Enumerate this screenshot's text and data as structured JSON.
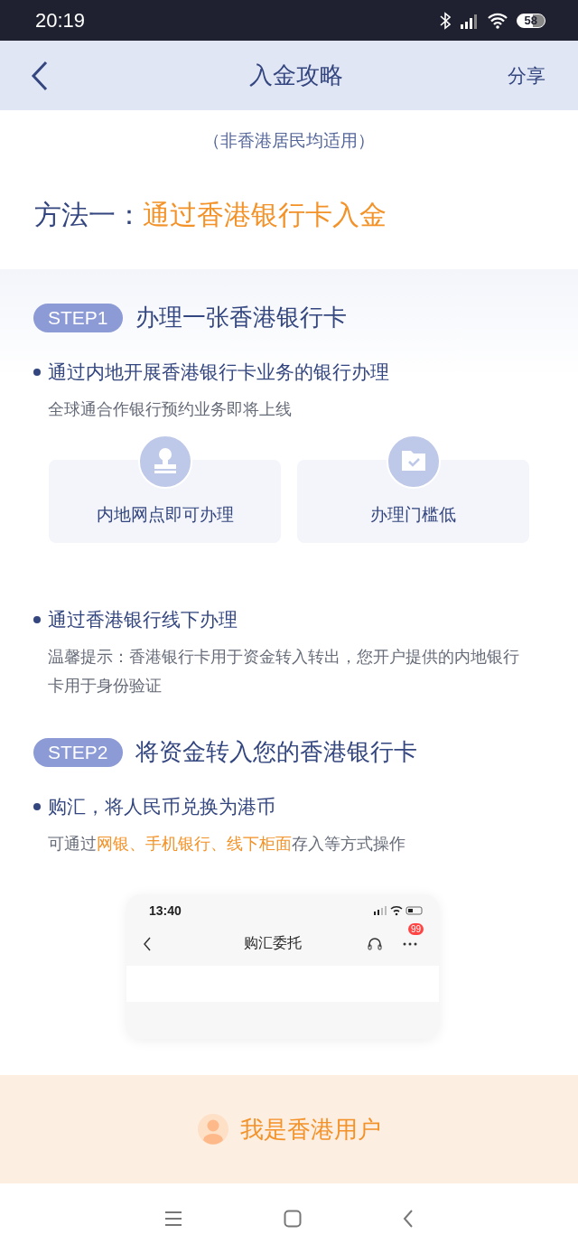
{
  "status_bar": {
    "time": "20:19",
    "battery": "58"
  },
  "nav": {
    "title": "入金攻略",
    "share": "分享"
  },
  "intro": {
    "subtitle": "（非香港居民均适用）",
    "method_label": "方法一：",
    "method_title": "通过香港银行卡入金"
  },
  "steps": [
    {
      "badge": "STEP1",
      "title": "办理一张香港银行卡",
      "blocks": [
        {
          "kind": "bullet",
          "title": "通过内地开展香港银行卡业务的银行办理",
          "note": [
            {
              "text": "全球通合作银行预约业务即将上线",
              "highlight": false
            }
          ]
        },
        {
          "kind": "features",
          "items": [
            {
              "kind": "stamp",
              "label": "内地网点即可办理"
            },
            {
              "kind": "folder",
              "label": "办理门槛低"
            }
          ]
        },
        {
          "kind": "bullet",
          "title": "通过香港银行线下办理",
          "note": [
            {
              "text": "温馨提示：香港银行卡用于资金转入转出，您开户提供的内地银行卡用于身份验证",
              "highlight": false
            }
          ]
        }
      ]
    },
    {
      "badge": "STEP2",
      "title": "将资金转入您的香港银行卡",
      "blocks": [
        {
          "kind": "bullet",
          "title": "购汇，将人民币兑换为港币",
          "note": [
            {
              "text": "可通过",
              "highlight": false
            },
            {
              "text": "网银、手机银行、线下柜面",
              "highlight": true
            },
            {
              "text": "存入等方式操作",
              "highlight": false
            }
          ]
        },
        {
          "kind": "mockup",
          "time": "13:40",
          "title": "购汇委托",
          "badge": "99"
        }
      ]
    }
  ],
  "hk_user_button": "我是香港用户"
}
